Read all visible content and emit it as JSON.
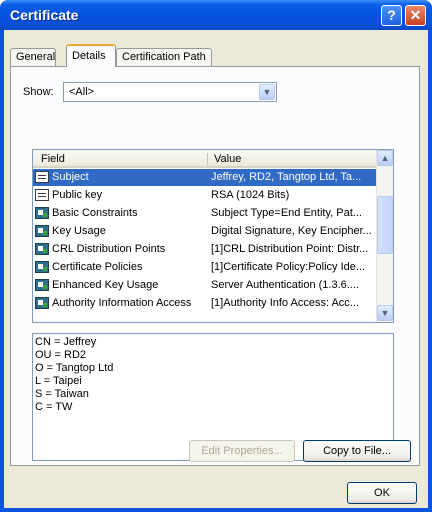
{
  "window": {
    "title": "Certificate",
    "help_glyph": "?",
    "close_glyph": "✕"
  },
  "tabs": [
    {
      "label": "General"
    },
    {
      "label": "Details"
    },
    {
      "label": "Certification Path"
    }
  ],
  "show": {
    "label": "Show:",
    "value": "<All>"
  },
  "list": {
    "columns": {
      "field": "Field",
      "value": "Value"
    },
    "rows": [
      {
        "field": "Subject",
        "value": "Jeffrey, RD2, Tangtop Ltd, Ta...",
        "icon": "plain-field-icon"
      },
      {
        "field": "Public key",
        "value": "RSA (1024 Bits)",
        "icon": "plain-field-icon"
      },
      {
        "field": "Basic Constraints",
        "value": "Subject Type=End Entity, Pat...",
        "icon": "extension-icon"
      },
      {
        "field": "Key Usage",
        "value": "Digital Signature, Key Encipher...",
        "icon": "extension-icon"
      },
      {
        "field": "CRL Distribution Points",
        "value": "[1]CRL Distribution Point: Distr...",
        "icon": "extension-icon"
      },
      {
        "field": "Certificate Policies",
        "value": "[1]Certificate Policy:Policy Ide...",
        "icon": "extension-icon"
      },
      {
        "field": "Enhanced Key Usage",
        "value": "Server Authentication (1.3.6....",
        "icon": "extension-icon"
      },
      {
        "field": "Authority Information Access",
        "value": "[1]Authority Info Access: Acc...",
        "icon": "extension-icon"
      }
    ]
  },
  "detail_lines": [
    "CN = Jeffrey",
    "OU = RD2",
    "O = Tangtop Ltd",
    "L = Taipei",
    "S = Taiwan",
    "C = TW"
  ],
  "buttons": {
    "edit_properties": "Edit Properties...",
    "copy_to_file": "Copy to File...",
    "ok": "OK"
  }
}
